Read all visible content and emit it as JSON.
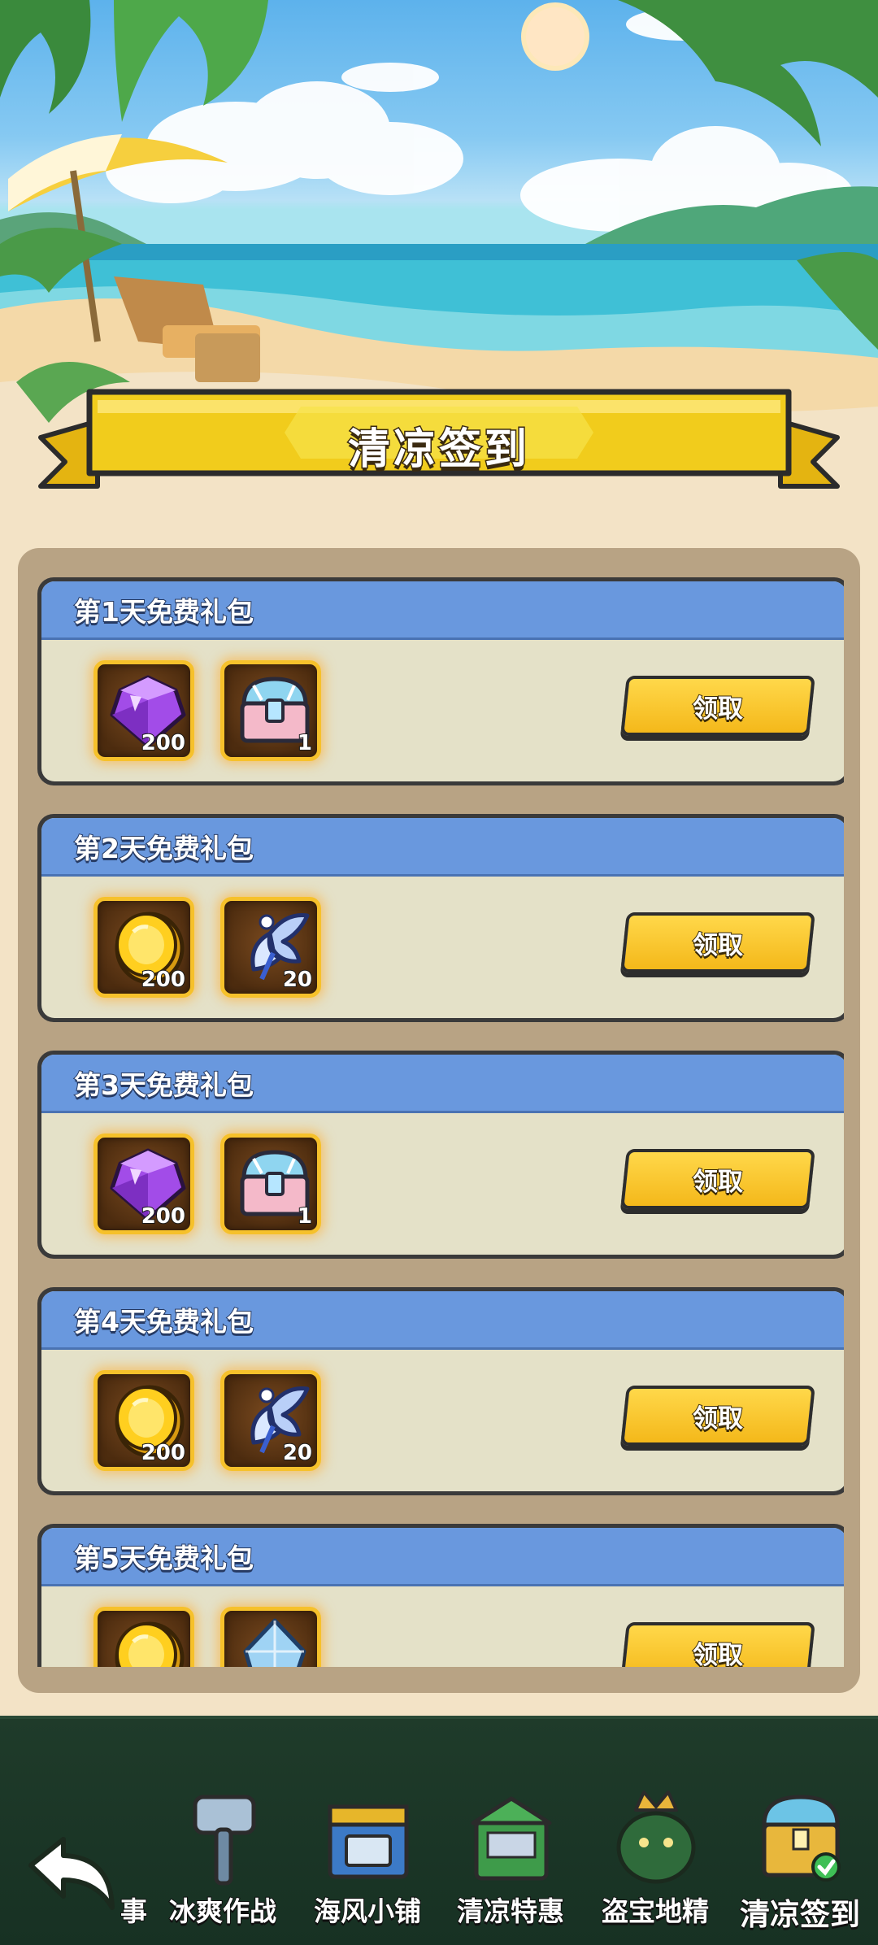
{
  "page": {
    "title": "清凉签到"
  },
  "days": [
    {
      "title": "第1天免费礼包",
      "claim_label": "领取",
      "rewards": [
        {
          "icon": "purple-gem-icon",
          "qty": "200"
        },
        {
          "icon": "treasure-chest-icon",
          "qty": "1"
        }
      ]
    },
    {
      "title": "第2天免费礼包",
      "claim_label": "领取",
      "rewards": [
        {
          "icon": "gold-coin-icon",
          "qty": "200"
        },
        {
          "icon": "blue-wing-shard-icon",
          "qty": "20"
        }
      ]
    },
    {
      "title": "第3天免费礼包",
      "claim_label": "领取",
      "rewards": [
        {
          "icon": "purple-gem-icon",
          "qty": "200"
        },
        {
          "icon": "treasure-chest-icon",
          "qty": "1"
        }
      ]
    },
    {
      "title": "第4天免费礼包",
      "claim_label": "领取",
      "rewards": [
        {
          "icon": "gold-coin-icon",
          "qty": "200"
        },
        {
          "icon": "blue-wing-shard-icon",
          "qty": "20"
        }
      ]
    },
    {
      "title": "第5天免费礼包",
      "claim_label": "领取",
      "rewards": [
        {
          "icon": "gold-coin-icon",
          "qty": ""
        },
        {
          "icon": "blue-crystal-icon",
          "qty": ""
        }
      ]
    }
  ],
  "nav": {
    "partial_label": "事",
    "items": [
      {
        "label": "冰爽作战",
        "icon": "hammer-icon",
        "active": false
      },
      {
        "label": "海风小铺",
        "icon": "shop-stall-icon",
        "active": false
      },
      {
        "label": "清凉特惠",
        "icon": "gift-box-icon",
        "active": false
      },
      {
        "label": "盗宝地精",
        "icon": "goblin-king-icon",
        "active": false
      },
      {
        "label": "清凉签到",
        "icon": "checkin-chest-icon",
        "active": true
      }
    ]
  },
  "colors": {
    "card_header": "#6998de",
    "card_body": "#e4e1c8",
    "claim_button": "#f4b81a",
    "banner": "#f1cc1c",
    "nav_background": "#1f3b2a"
  }
}
